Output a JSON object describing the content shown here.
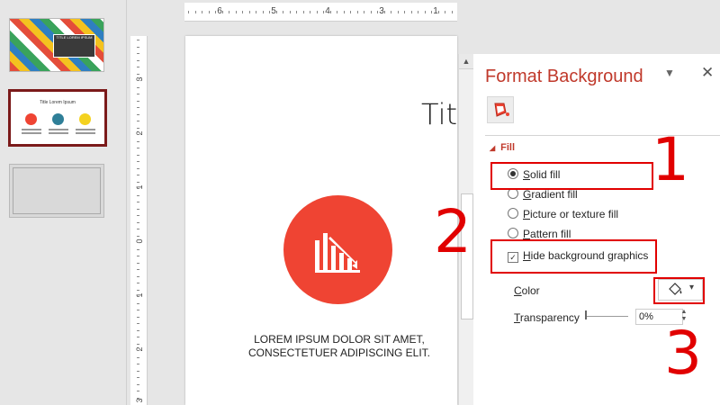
{
  "thumbnails": [
    {
      "title": "TITLE LOREM IPSUM",
      "selected": false
    },
    {
      "title": "Title Lorem Ipsum",
      "selected": true
    },
    {
      "title": "",
      "selected": false
    }
  ],
  "hruler": [
    "6",
    "5",
    "4",
    "3",
    "1"
  ],
  "vruler": [
    "3",
    "2",
    "1",
    "0",
    "1",
    "2",
    "3"
  ],
  "slide": {
    "title": "Titl",
    "body_line1": "LOREM IPSUM DOLOR SIT AMET,",
    "body_line2": "CONSECTETUER ADIPISCING ELIT.",
    "circle_color": "#ef4433",
    "icon": "chart-icon"
  },
  "scrollbar": {
    "up": "▲"
  },
  "pane": {
    "title": "Format Background",
    "menu": "▼",
    "close": "✕",
    "tab_icon": "paint-bucket-icon",
    "fill_header": "Fill",
    "fill_toggle": "◢",
    "options": {
      "solid": {
        "label": "Solid fill",
        "accel": "S",
        "rest": "olid fill",
        "selected": true
      },
      "gradient": {
        "label": "Gradient fill",
        "accel": "G",
        "rest": "radient fill"
      },
      "picture": {
        "label": "Picture or texture fill",
        "accel": "P",
        "rest": "icture or texture fill"
      },
      "pattern": {
        "label": "Pattern fill",
        "accel": "P",
        "rest": "attern fill"
      }
    },
    "hide_bg": {
      "accel": "H",
      "rest": "ide background graphics",
      "checked": true,
      "check": "✓"
    },
    "color_label_accel": "C",
    "color_label_rest": "olor",
    "color_dropdown": "▾",
    "transparency_accel": "T",
    "transparency_rest": "ransparency",
    "transparency_value": "0%",
    "spin_up": "▲",
    "spin_down": "▼"
  },
  "annotations": [
    "1",
    "2",
    "3"
  ],
  "colors": {
    "accent": "#c0392b",
    "annotation": "#e10000"
  }
}
